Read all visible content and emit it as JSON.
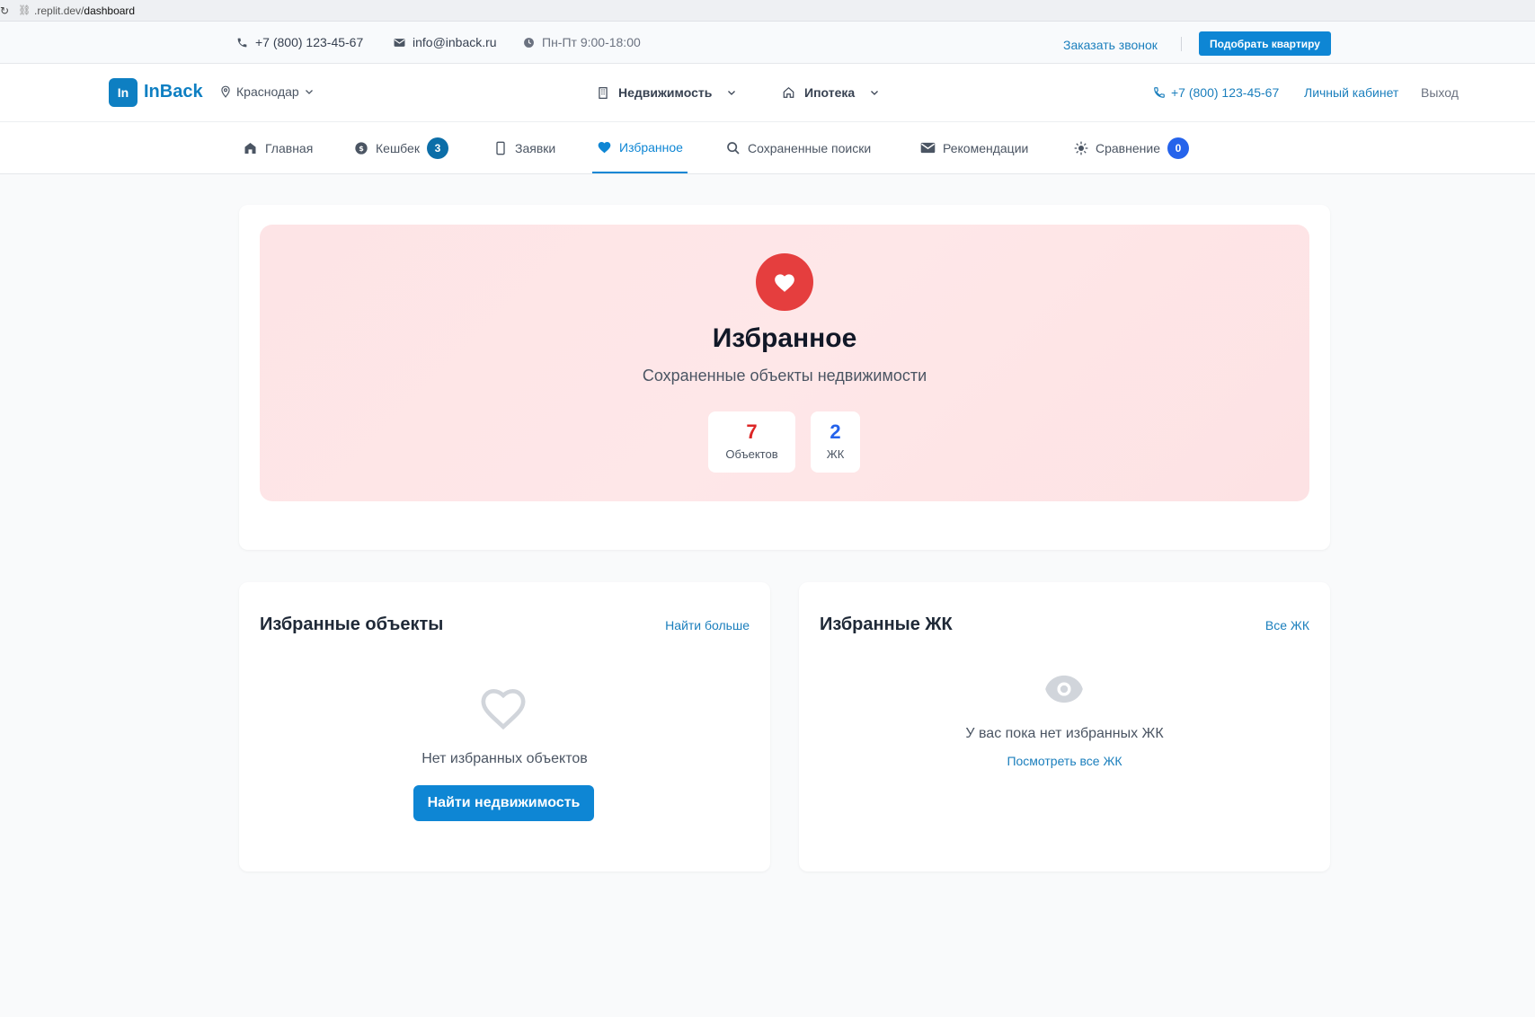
{
  "browser": {
    "url_prefix": ".replit.dev/",
    "url_path": "dashboard"
  },
  "topbar": {
    "phone": "+7 (800) 123-45-67",
    "email": "info@inback.ru",
    "hours": "Пн-Пт 9:00-18:00",
    "callback": "Заказать звонок",
    "pick_button": "Подобрать квартиру"
  },
  "header": {
    "logo_mark": "In",
    "logo_text": "InBack",
    "city": "Краснодар",
    "nav": [
      {
        "label": "Недвижимость",
        "icon": "building-icon"
      },
      {
        "label": "Ипотека",
        "icon": "house-icon"
      }
    ],
    "phone": "+7 (800) 123-45-67",
    "cabinet": "Личный кабинет",
    "logout": "Выход"
  },
  "tabs": [
    {
      "label": "Главная",
      "icon": "home-icon"
    },
    {
      "label": "Кешбек",
      "icon": "coin-icon",
      "badge": "3"
    },
    {
      "label": "Заявки",
      "icon": "phone-icon"
    },
    {
      "label": "Избранное",
      "icon": "heart-icon",
      "active": true
    },
    {
      "label": "Сохраненные поиски",
      "icon": "search-icon"
    },
    {
      "label": "Рекомендации",
      "icon": "envelope-icon"
    },
    {
      "label": "Сравнение",
      "icon": "sun-icon",
      "badge": "0"
    }
  ],
  "hero": {
    "title": "Избранное",
    "subtitle": "Сохраненные объекты недвижимости",
    "stats": [
      {
        "value": "7",
        "label": "Объектов",
        "color": "#dc2626"
      },
      {
        "value": "2",
        "label": "ЖК",
        "color": "#2563eb"
      }
    ]
  },
  "objects": {
    "title": "Избранные объекты",
    "link": "Найти больше",
    "empty": "Нет избранных объектов",
    "button": "Найти недвижимость"
  },
  "complexes": {
    "title": "Избранные ЖК",
    "link": "Все ЖК",
    "empty": "У вас пока нет избранных ЖК",
    "view_all": "Посмотреть все ЖК"
  },
  "colors": {
    "accent": "#0e86d4",
    "brand": "#0e7fc2",
    "heart": "#e53e3e",
    "badge_dark": "#0c6ea8",
    "badge_blue": "#2563eb"
  }
}
